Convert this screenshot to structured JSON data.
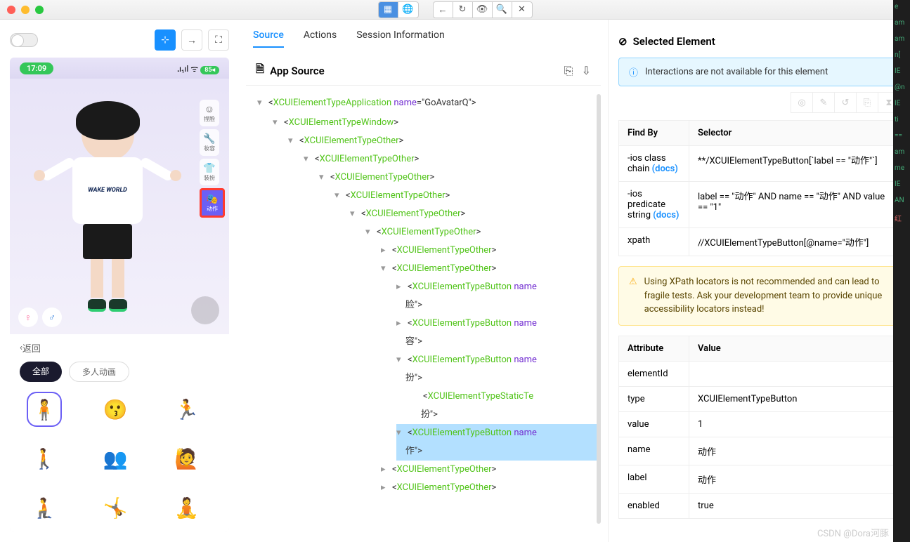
{
  "titlebar": {
    "close": "close",
    "min": "minimize",
    "max": "maximize"
  },
  "top_tools": {
    "grid": "▦",
    "globe": "🌐",
    "back": "←",
    "refresh": "↻",
    "eye": "👁",
    "search": "🔍",
    "close": "✕"
  },
  "left": {
    "selector_icon": "⊹",
    "swap_icon": "→",
    "fullscreen_icon": "⛶",
    "status_time": "17:09",
    "signal": "᎐ı₁ıl ᯤ",
    "battery": "85◂",
    "tshirt": "WAKE WORLD",
    "side_icons": [
      {
        "icon": "☺",
        "label": "捏脸"
      },
      {
        "icon": "🔧",
        "label": "妆容"
      },
      {
        "icon": "👕",
        "label": "装扮"
      },
      {
        "icon": "🎭",
        "label": "动作"
      }
    ],
    "back_label": "返回",
    "pills": [
      "全部",
      "多人动画"
    ],
    "grid_icons": [
      "🧍",
      "😗",
      "🏃",
      "🚶",
      "👥",
      "🙋",
      "🧎",
      "🤸",
      "🧘"
    ]
  },
  "tabs": [
    "Source",
    "Actions",
    "Session Information"
  ],
  "source_panel": {
    "title": "App Source",
    "copy_icon": "⎘",
    "download_icon": "⇩",
    "app_name": "GoAvatarQ",
    "tree_tags": {
      "app": "XCUIElementTypeApplication",
      "win": "XCUIElementTypeWindow",
      "other": "XCUIElementTypeOther",
      "btn": "XCUIElementTypeButton",
      "static": "XCUIElementTypeStaticTe"
    },
    "name_attr": "name",
    "btn_suffix_1": "脸\">",
    "btn_suffix_2": "容\">",
    "btn_suffix_3": "扮\">",
    "static_suffix": "扮\">",
    "btn_suffix_4": "作\">"
  },
  "selected": {
    "title": "Selected Element",
    "info_msg": "Interactions are not available for this element",
    "findby_header": "Find By",
    "selector_header": "Selector",
    "rows": [
      {
        "k": "-ios class chain ",
        "docs": "(docs)",
        "v": "**/XCUIElementTypeButton[`label == \"动作\"`]"
      },
      {
        "k": "-ios predicate string ",
        "docs": "(docs)",
        "v": "label == \"动作\" AND name == \"动作\" AND value == \"1\""
      },
      {
        "k": "xpath",
        "docs": "",
        "v": "//XCUIElementTypeButton[@name=\"动作\"]"
      }
    ],
    "warn_msg": "Using XPath locators is not recommended and can lead to fragile tests. Ask your development team to provide unique accessibility locators instead!",
    "attr_header": "Attribute",
    "val_header": "Value",
    "attrs": [
      {
        "k": "elementId",
        "v": ""
      },
      {
        "k": "type",
        "v": "XCUIElementTypeButton"
      },
      {
        "k": "value",
        "v": "1"
      },
      {
        "k": "name",
        "v": "动作"
      },
      {
        "k": "label",
        "v": "动作"
      },
      {
        "k": "enabled",
        "v": "true"
      }
    ]
  },
  "dark_snippets": [
    "e",
    "am",
    "am",
    "n[",
    "IE",
    "@n",
    "IE",
    "ti",
    "==",
    "",
    "am",
    "me",
    "IE",
    "AN",
    "红"
  ],
  "watermark": "CSDN @Dora河豚"
}
